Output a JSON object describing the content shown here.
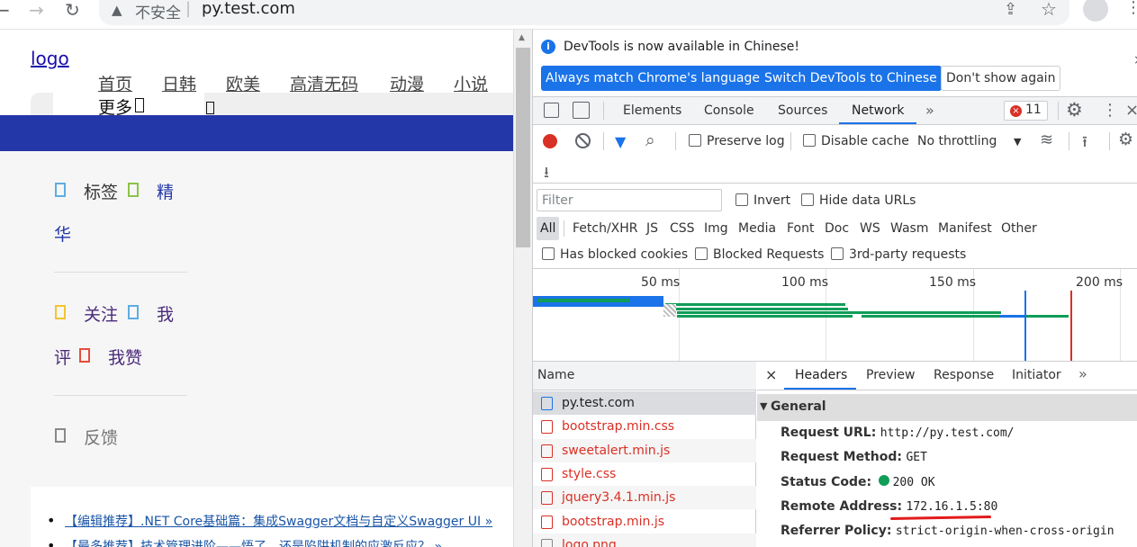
{
  "browser": {
    "security_label": "不安全",
    "url": "py.test.com"
  },
  "page": {
    "logo_alt": "logo",
    "nav": [
      "首页",
      "日韩",
      "欧美",
      "高清无码",
      "动漫",
      "小说"
    ],
    "nav_more": "更多",
    "side": {
      "tags": "标签",
      "essence_1": "精",
      "essence_2": "华",
      "follow": "关注",
      "my_comments_1": "我",
      "my_comments_2": "评",
      "my_likes": "我赞",
      "feedback": "反馈"
    },
    "articles": [
      "【编辑推荐】.NET Core基础篇：集成Swagger文档与自定义Swagger UI »",
      "【最多推荐】技术管理进阶——悟了，还是陷阱机制的应激反应？ »"
    ]
  },
  "devtools": {
    "notice": "DevTools is now available in Chinese!",
    "btn_match": "Always match Chrome's language",
    "btn_switch": "Switch DevTools to Chinese",
    "btn_dismiss": "Don't show again",
    "tabs": [
      "Elements",
      "Console",
      "Sources",
      "Network"
    ],
    "active_tab": "Network",
    "error_count": "11",
    "toolbar": {
      "preserve_log": "Preserve log",
      "disable_cache": "Disable cache",
      "throttling": "No throttling"
    },
    "filter_placeholder": "Filter",
    "invert": "Invert",
    "hide_data_urls": "Hide data URLs",
    "type_filters": [
      "All",
      "Fetch/XHR",
      "JS",
      "CSS",
      "Img",
      "Media",
      "Font",
      "Doc",
      "WS",
      "Wasm",
      "Manifest",
      "Other"
    ],
    "has_blocked_cookies": "Has blocked cookies",
    "blocked_requests": "Blocked Requests",
    "third_party": "3rd-party requests",
    "timeline_ticks": [
      "50 ms",
      "100 ms",
      "150 ms",
      "200 ms"
    ],
    "name_header": "Name",
    "requests": [
      {
        "name": "py.test.com",
        "type": "doc",
        "color": "#202124"
      },
      {
        "name": "bootstrap.min.css",
        "type": "css",
        "color": "#d93025"
      },
      {
        "name": "sweetalert.min.js",
        "type": "js",
        "color": "#d93025"
      },
      {
        "name": "style.css",
        "type": "css",
        "color": "#d93025"
      },
      {
        "name": "jquery3.4.1.min.js",
        "type": "js",
        "color": "#d93025"
      },
      {
        "name": "bootstrap.min.js",
        "type": "js",
        "color": "#d93025"
      },
      {
        "name": "logo.png",
        "type": "img",
        "color": "#d93025"
      }
    ],
    "detail_tabs": [
      "Headers",
      "Preview",
      "Response",
      "Initiator"
    ],
    "general_title": "General",
    "headers": [
      {
        "key": "Request URL:",
        "value": "http://py.test.com/"
      },
      {
        "key": "Request Method:",
        "value": "GET"
      },
      {
        "key": "Status Code:",
        "value": "200 OK"
      },
      {
        "key": "Remote Address:",
        "value": "172.16.1.5:80"
      },
      {
        "key": "Referrer Policy:",
        "value": "strict-origin-when-cross-origin"
      }
    ],
    "colors": {
      "accent": "#1a73e8",
      "record": "#d93025",
      "status_ok": "#0f9d58"
    }
  }
}
